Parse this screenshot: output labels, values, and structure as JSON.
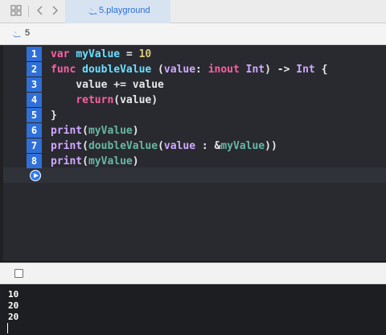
{
  "tabbar": {
    "grid_icon": "grid-icon",
    "back_icon": "chevron-left-icon",
    "forward_icon": "chevron-right-icon",
    "tab_title": "5.playground"
  },
  "breadcrumb": {
    "label": "5"
  },
  "editor": {
    "line_numbers": [
      "1",
      "2",
      "3",
      "4",
      "5",
      "6",
      "7",
      "8"
    ],
    "lines": [
      [
        {
          "t": "var",
          "c": "kw"
        },
        {
          "t": " "
        },
        {
          "t": "myValue",
          "c": "fn"
        },
        {
          "t": " = "
        },
        {
          "t": "10",
          "c": "num"
        }
      ],
      [
        {
          "t": "func",
          "c": "kw"
        },
        {
          "t": " "
        },
        {
          "t": "doubleValue",
          "c": "fn"
        },
        {
          "t": " ("
        },
        {
          "t": "value",
          "c": "ty"
        },
        {
          "t": ": "
        },
        {
          "t": "inout",
          "c": "kw"
        },
        {
          "t": " "
        },
        {
          "t": "Int",
          "c": "ty"
        },
        {
          "t": ") -> "
        },
        {
          "t": "Int",
          "c": "ty"
        },
        {
          "t": " {"
        }
      ],
      [
        {
          "t": "    value += value"
        }
      ],
      [
        {
          "t": "    "
        },
        {
          "t": "return",
          "c": "kw"
        },
        {
          "t": "(value)"
        }
      ],
      [
        {
          "t": "}"
        }
      ],
      [
        {
          "t": "print",
          "c": "ty"
        },
        {
          "t": "("
        },
        {
          "t": "myValue",
          "c": "id"
        },
        {
          "t": ")"
        }
      ],
      [
        {
          "t": "print",
          "c": "ty"
        },
        {
          "t": "("
        },
        {
          "t": "doubleValue",
          "c": "id"
        },
        {
          "t": "("
        },
        {
          "t": "value",
          "c": "ty"
        },
        {
          "t": " : &"
        },
        {
          "t": "myValue",
          "c": "id"
        },
        {
          "t": "))"
        }
      ],
      [
        {
          "t": "print",
          "c": "ty"
        },
        {
          "t": "("
        },
        {
          "t": "myValue",
          "c": "id"
        },
        {
          "t": ")"
        }
      ]
    ],
    "run_icon": "play-icon"
  },
  "debug": {
    "toggle_icon": "console-toggle-icon"
  },
  "console": {
    "output": [
      "10",
      "20",
      "20"
    ]
  },
  "colors": {
    "keyword": "#fc5fa3",
    "type": "#d0a8ff",
    "function": "#6bdfff",
    "number": "#d9c97c",
    "identifier": "#67b7a4",
    "accent": "#2f6fd8"
  }
}
